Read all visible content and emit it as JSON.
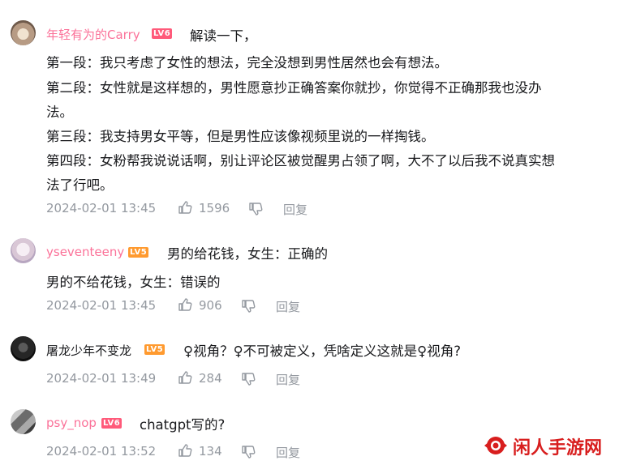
{
  "comments": [
    {
      "username": "年轻有为的Carry",
      "level": "LV6",
      "lines": [
        "解读一下，",
        "第一段：我只考虑了女性的想法，完全没想到男性居然也会有想法。",
        "第二段：女性就是这样想的，男性愿意抄正确答案你就抄，你觉得不正确那我也没办",
        "法。",
        "第三段：我支持男女平等，但是男性应该像视频里说的一样掏钱。",
        "第四段：女粉帮我说说话啊，别让评论区被觉醒男占领了啊，大不了以后我不说真实想",
        "法了行吧。"
      ],
      "time": "2024-02-01 13:45",
      "likes": "1596",
      "reply": "回复"
    },
    {
      "username": "yseventeeny",
      "level": "LV5",
      "lines": [
        "男的给花钱，女生：正确的",
        "男的不给花钱，女生：错误的"
      ],
      "time": "2024-02-01 13:45",
      "likes": "906",
      "reply": "回复"
    },
    {
      "username": "屠龙少年不变龙",
      "level": "LV5",
      "lines": [
        "♀视角？♀不可被定义，凭啥定义这就是♀视角?"
      ],
      "time": "2024-02-01 13:49",
      "likes": "284",
      "reply": "回复"
    },
    {
      "username": "psy_nop",
      "level": "LV6",
      "lines": [
        "chatgpt写的?"
      ],
      "time": "2024-02-01 13:52",
      "likes": "134",
      "reply": "回复"
    }
  ],
  "watermark": {
    "text": "闲人手游网",
    "color": "#d81e1e"
  },
  "colors": {
    "username": "#fb7299",
    "meta": "#9499a0",
    "lv6": "#ff5a7a",
    "lv5": "#ff9a2f"
  },
  "icons": {
    "like": "thumbs-up-icon",
    "dislike": "thumbs-down-icon"
  }
}
